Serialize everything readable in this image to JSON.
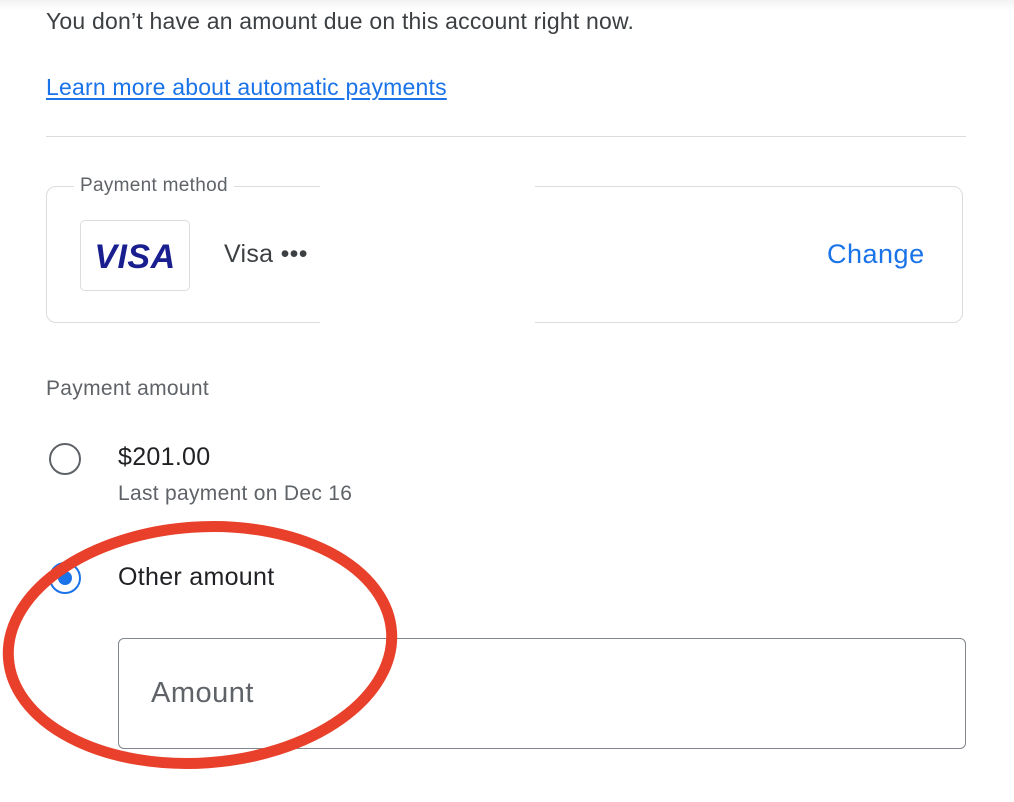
{
  "account": {
    "due_message": "You don’t have an amount due on this account right now.",
    "learn_more_link": "Learn more about automatic payments"
  },
  "payment_method": {
    "legend": "Payment method",
    "card_brand_logo": "VISA",
    "card_label": "Visa •••",
    "change_label": "Change"
  },
  "payment_amount": {
    "label": "Payment amount",
    "options": [
      {
        "label": "$201.00",
        "sublabel": "Last payment on Dec 16",
        "selected": false
      },
      {
        "label": "Other amount",
        "selected": true
      }
    ],
    "amount_input": {
      "placeholder": "Amount",
      "value": ""
    }
  },
  "annotation": {
    "shape": "ellipse",
    "color": "#e8402a",
    "target": "amount-input"
  },
  "colors": {
    "accent": "#1a73e8",
    "visa_blue": "#1a1f8f",
    "border": "#dadce0",
    "text_primary": "#202124",
    "text_secondary": "#5f6368"
  }
}
